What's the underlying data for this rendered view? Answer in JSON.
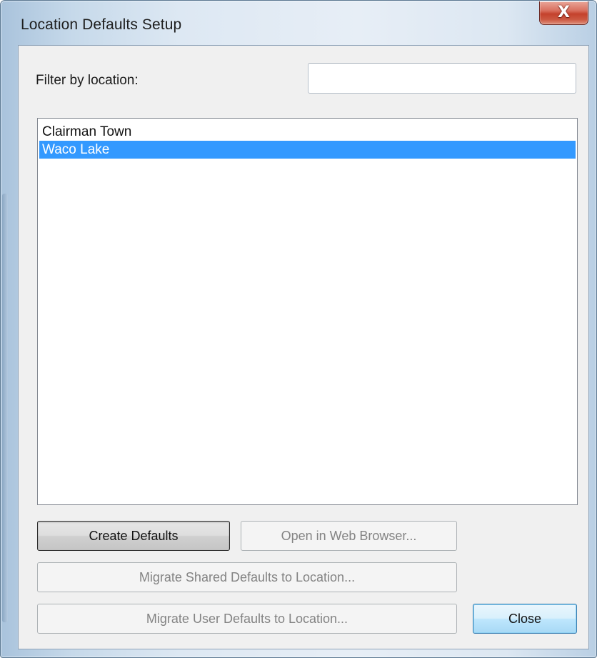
{
  "window": {
    "title": "Location Defaults Setup",
    "close_glyph": "X"
  },
  "filter": {
    "label": "Filter by location:",
    "value": "",
    "placeholder": ""
  },
  "locations": {
    "items": [
      {
        "label": "Clairman Town",
        "selected": false
      },
      {
        "label": "Waco Lake",
        "selected": true
      }
    ]
  },
  "buttons": {
    "create_defaults": "Create Defaults",
    "open_in_web_browser": "Open in Web Browser...",
    "migrate_shared": "Migrate Shared Defaults to Location...",
    "migrate_user": "Migrate User Defaults to Location...",
    "close": "Close"
  },
  "colors": {
    "selection": "#3399ff",
    "close_button_red": "#c4412c",
    "default_button_blue": "#bee6fd"
  },
  "icons": {
    "close": "close-icon"
  }
}
